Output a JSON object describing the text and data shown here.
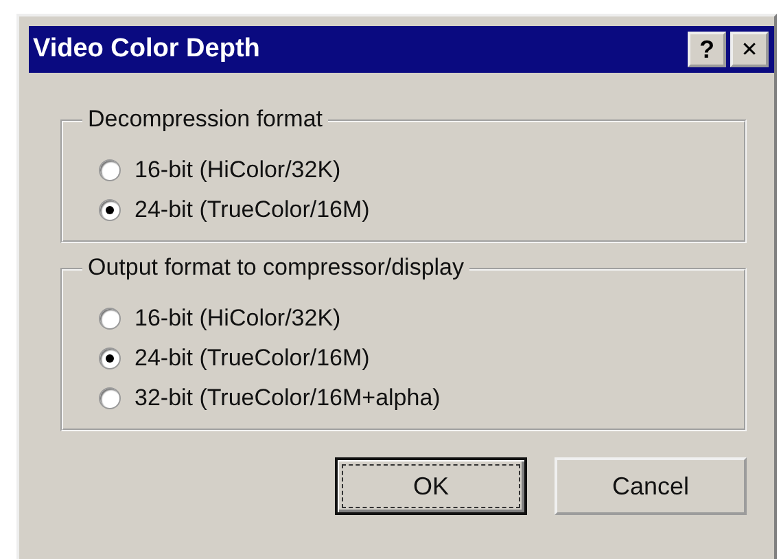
{
  "window": {
    "title": "Video Color Depth",
    "title_buttons": [
      {
        "kind": "help",
        "label": "?"
      },
      {
        "kind": "close",
        "label": "✕"
      }
    ]
  },
  "groups": [
    {
      "title": "Decompression format",
      "options": [
        {
          "label": "16-bit (HiColor/32K)",
          "selected": false
        },
        {
          "label": "24-bit (TrueColor/16M)",
          "selected": true
        }
      ]
    },
    {
      "title": "Output format to compressor/display",
      "options": [
        {
          "label": "16-bit (HiColor/32K)",
          "selected": false
        },
        {
          "label": "24-bit (TrueColor/16M)",
          "selected": true
        },
        {
          "label": "32-bit (TrueColor/16M+alpha)",
          "selected": false
        }
      ]
    }
  ],
  "buttons": [
    {
      "label": "OK",
      "default": true
    },
    {
      "label": "Cancel",
      "default": false
    }
  ]
}
